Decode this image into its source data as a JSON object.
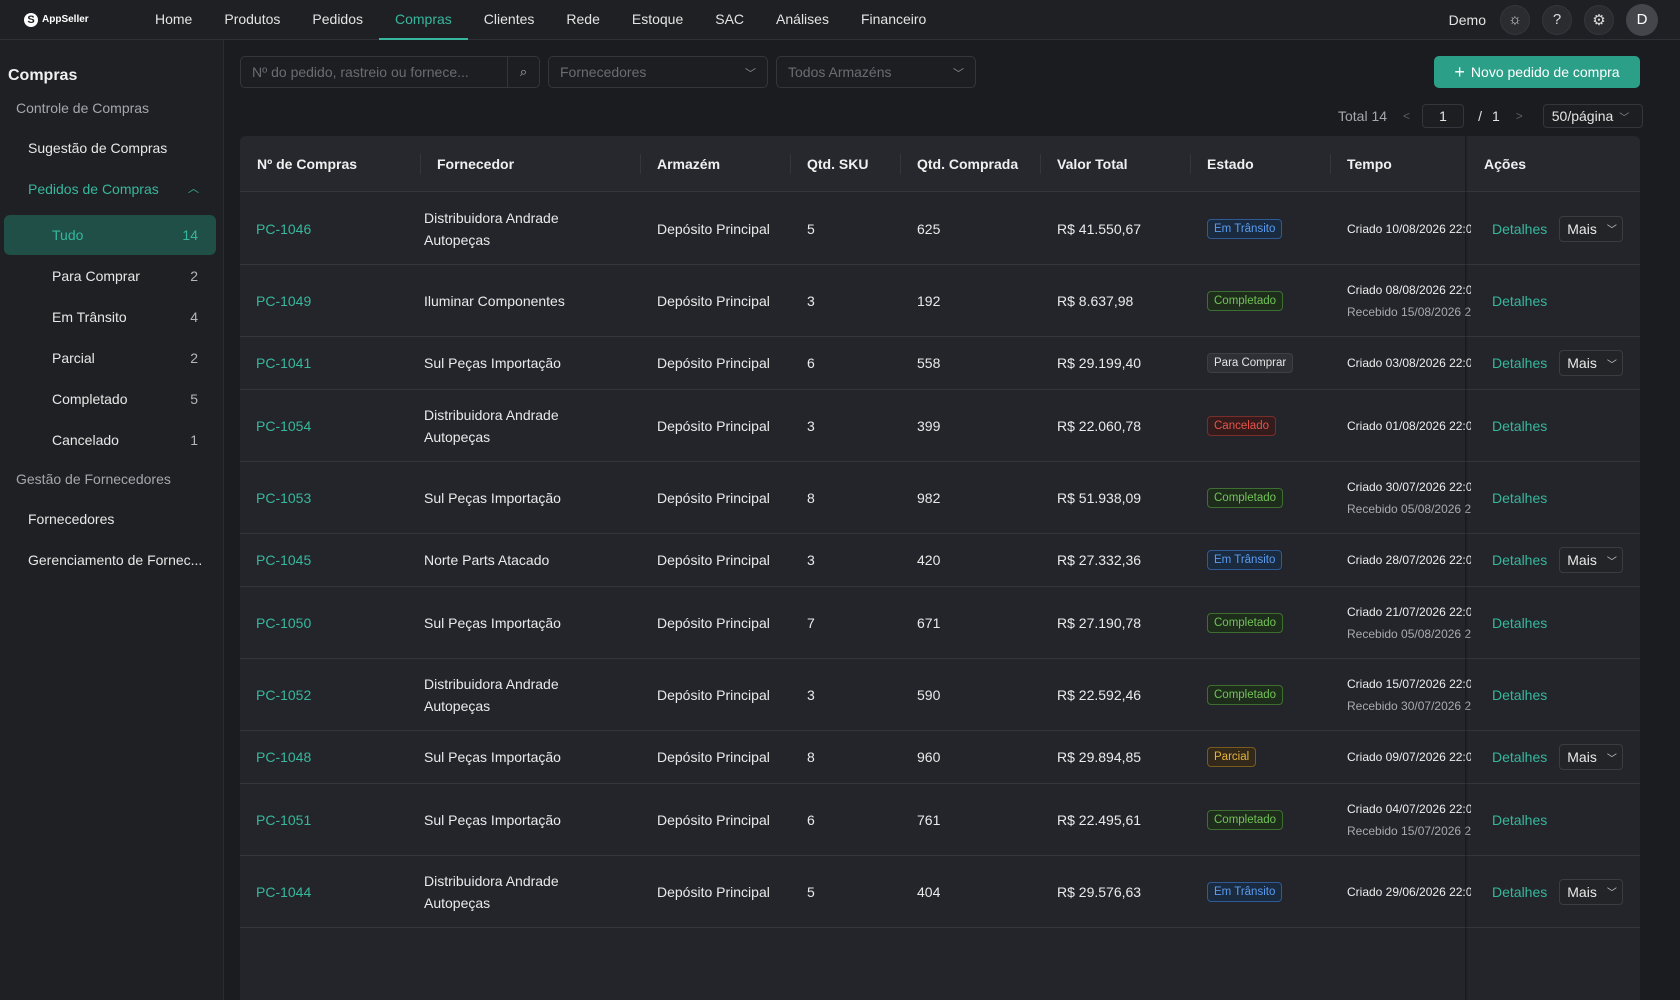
{
  "app": {
    "logo_text": "AppSeller"
  },
  "nav": {
    "items": [
      {
        "label": "Home"
      },
      {
        "label": "Produtos"
      },
      {
        "label": "Pedidos"
      },
      {
        "label": "Compras",
        "active": true
      },
      {
        "label": "Clientes"
      },
      {
        "label": "Rede"
      },
      {
        "label": "Estoque"
      },
      {
        "label": "SAC"
      },
      {
        "label": "Análises"
      },
      {
        "label": "Financeiro"
      }
    ],
    "user_name": "Demo",
    "avatar_initial": "D"
  },
  "sidebar": {
    "title": "Compras",
    "group1": "Controle de Compras",
    "suggestion": "Sugestão de Compras",
    "orders": "Pedidos de Compras",
    "subs": [
      {
        "label": "Tudo",
        "count": "14",
        "active": true
      },
      {
        "label": "Para Comprar",
        "count": "2"
      },
      {
        "label": "Em Trânsito",
        "count": "4"
      },
      {
        "label": "Parcial",
        "count": "2"
      },
      {
        "label": "Completado",
        "count": "5"
      },
      {
        "label": "Cancelado",
        "count": "1"
      }
    ],
    "group2": "Gestão de Fornecedores",
    "suppliers": "Fornecedores",
    "supplier_mgmt": "Gerenciamento de Fornec..."
  },
  "toolbar": {
    "search_placeholder": "Nº do pedido, rastreio ou fornece...",
    "supplier_select": "Fornecedores",
    "warehouse_select": "Todos Armazéns",
    "new_button": "Novo pedido de compra"
  },
  "pagination": {
    "total": "Total 14",
    "page": "1",
    "slash": "/",
    "pages": "1",
    "per_page": "50/página"
  },
  "table": {
    "headers": {
      "id": "Nº de Compras",
      "supplier": "Fornecedor",
      "warehouse": "Armazém",
      "sku": "Qtd. SKU",
      "qty": "Qtd. Comprada",
      "total": "Valor Total",
      "status": "Estado",
      "time": "Tempo",
      "actions": "Ações"
    },
    "details_label": "Detalhes",
    "more_label": "Mais",
    "rows": [
      {
        "id": "PC-1046",
        "supplier_l1": "Distribuidora Andrade",
        "supplier_l2": "Autopeças",
        "warehouse": "Depósito Principal",
        "sku": "5",
        "qty": "625",
        "total": "R$ 41.550,67",
        "status": "Em Trânsito",
        "created": "Criado 10/08/2026 22:0",
        "received": "",
        "more": true
      },
      {
        "id": "PC-1049",
        "supplier_l1": "Iluminar Componentes",
        "supplier_l2": "",
        "warehouse": "Depósito Principal",
        "sku": "3",
        "qty": "192",
        "total": "R$ 8.637,98",
        "status": "Completado",
        "created": "Criado 08/08/2026 22:0",
        "received": "Recebido 15/08/2026 2",
        "more": false
      },
      {
        "id": "PC-1041",
        "supplier_l1": "Sul Peças Importação",
        "supplier_l2": "",
        "warehouse": "Depósito Principal",
        "sku": "6",
        "qty": "558",
        "total": "R$ 29.199,40",
        "status": "Para Comprar",
        "created": "Criado 03/08/2026 22:0",
        "received": "",
        "more": true
      },
      {
        "id": "PC-1054",
        "supplier_l1": "Distribuidora Andrade",
        "supplier_l2": "Autopeças",
        "warehouse": "Depósito Principal",
        "sku": "3",
        "qty": "399",
        "total": "R$ 22.060,78",
        "status": "Cancelado",
        "created": "Criado 01/08/2026 22:0",
        "received": "",
        "more": false
      },
      {
        "id": "PC-1053",
        "supplier_l1": "Sul Peças Importação",
        "supplier_l2": "",
        "warehouse": "Depósito Principal",
        "sku": "8",
        "qty": "982",
        "total": "R$ 51.938,09",
        "status": "Completado",
        "created": "Criado 30/07/2026 22:0",
        "received": "Recebido 05/08/2026 2",
        "more": false
      },
      {
        "id": "PC-1045",
        "supplier_l1": "Norte Parts Atacado",
        "supplier_l2": "",
        "warehouse": "Depósito Principal",
        "sku": "3",
        "qty": "420",
        "total": "R$ 27.332,36",
        "status": "Em Trânsito",
        "created": "Criado 28/07/2026 22:0",
        "received": "",
        "more": true
      },
      {
        "id": "PC-1050",
        "supplier_l1": "Sul Peças Importação",
        "supplier_l2": "",
        "warehouse": "Depósito Principal",
        "sku": "7",
        "qty": "671",
        "total": "R$ 27.190,78",
        "status": "Completado",
        "created": "Criado 21/07/2026 22:0",
        "received": "Recebido 05/08/2026 2",
        "more": false
      },
      {
        "id": "PC-1052",
        "supplier_l1": "Distribuidora Andrade",
        "supplier_l2": "Autopeças",
        "warehouse": "Depósito Principal",
        "sku": "3",
        "qty": "590",
        "total": "R$ 22.592,46",
        "status": "Completado",
        "created": "Criado 15/07/2026 22:0",
        "received": "Recebido 30/07/2026 2",
        "more": false
      },
      {
        "id": "PC-1048",
        "supplier_l1": "Sul Peças Importação",
        "supplier_l2": "",
        "warehouse": "Depósito Principal",
        "sku": "8",
        "qty": "960",
        "total": "R$ 29.894,85",
        "status": "Parcial",
        "created": "Criado 09/07/2026 22:0",
        "received": "",
        "more": true
      },
      {
        "id": "PC-1051",
        "supplier_l1": "Sul Peças Importação",
        "supplier_l2": "",
        "warehouse": "Depósito Principal",
        "sku": "6",
        "qty": "761",
        "total": "R$ 22.495,61",
        "status": "Completado",
        "created": "Criado 04/07/2026 22:0",
        "received": "Recebido 15/07/2026 2",
        "more": false
      },
      {
        "id": "PC-1044",
        "supplier_l1": "Distribuidora Andrade",
        "supplier_l2": "Autopeças",
        "warehouse": "Depósito Principal",
        "sku": "5",
        "qty": "404",
        "total": "R$ 29.576,63",
        "status": "Em Trânsito",
        "created": "Criado 29/06/2026 22:0",
        "received": "",
        "more": true
      }
    ]
  },
  "status_colors": {
    "Em Trânsito": {
      "text": "#5b9cf0",
      "border": "#2f5a95",
      "bg": "#1a2a3f"
    },
    "Completado": {
      "text": "#73c25a",
      "border": "#3f6e32",
      "bg": "#1e2c1b"
    },
    "Para Comprar": {
      "text": "#e4e4e4",
      "border": "#3d3f44",
      "bg": "#2e3035"
    },
    "Cancelado": {
      "text": "#e5534b",
      "border": "#7a2e2b",
      "bg": "#351c1c"
    },
    "Parcial": {
      "text": "#e6b33c",
      "border": "#7a5b1e",
      "bg": "#33291a"
    }
  },
  "accent_color": "#37b79d"
}
